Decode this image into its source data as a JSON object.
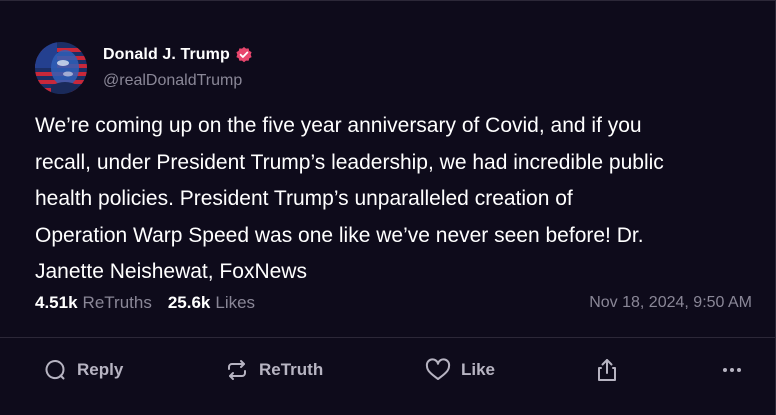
{
  "post": {
    "author": {
      "display_name": "Donald J. Trump",
      "handle": "@realDonaldTrump",
      "verified": true,
      "verified_badge_color": "#e8466d"
    },
    "text": "We’re coming up on the five year anniversary of Covid, and if you\nrecall, under President Trump’s leadership, we had incredible public\nhealth policies. President Trump’s unparalleled creation of\nOperation Warp Speed was one like we’ve never seen before! Dr.\nJanette Neishewat, FoxNews",
    "stats": {
      "retruths_count": "4.51k",
      "retruths_label": "ReTruths",
      "likes_count": "25.6k",
      "likes_label": "Likes"
    },
    "timestamp": "Nov 18, 2024, 9:50 AM"
  },
  "actions": {
    "reply_label": "Reply",
    "retruth_label": "ReTruth",
    "like_label": "Like"
  },
  "icons": {
    "reply": "speech-bubble-icon",
    "retruth": "repost-arrows-icon",
    "like": "heart-icon",
    "share": "share-upload-icon",
    "more": "ellipsis-icon"
  },
  "theme": {
    "background": "#0e0b1b",
    "text_primary": "#ffffff",
    "text_secondary": "#8a8797",
    "divider": "#2c2838"
  }
}
